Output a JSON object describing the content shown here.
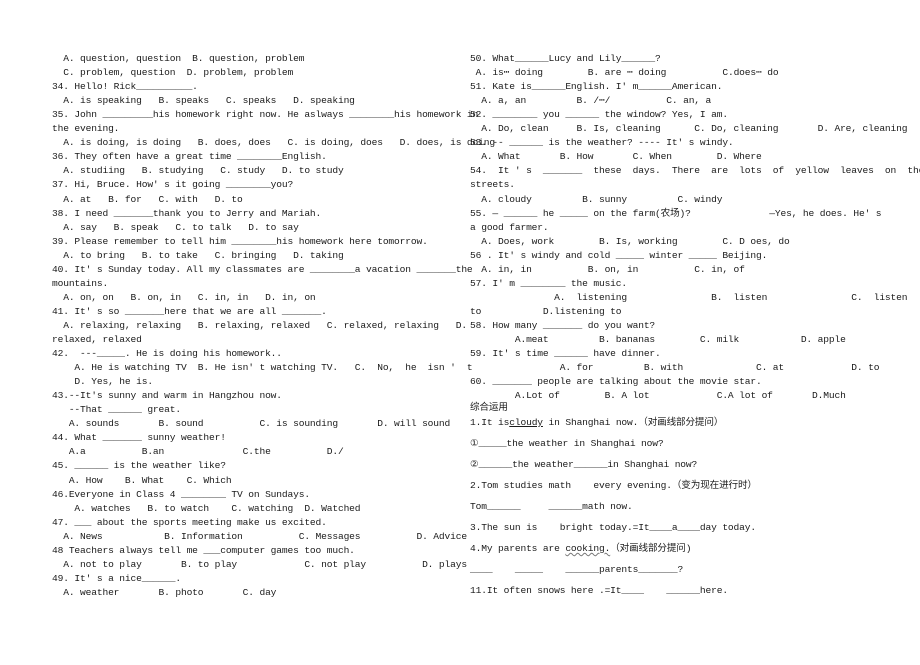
{
  "left_column": [
    {
      "text": "  A. question, question  B. question, problem"
    },
    {
      "text": "  C. problem, question  D. problem, problem"
    },
    {
      "text": "34. Hello! Rick__________."
    },
    {
      "text": "  A. is speaking   B. speaks   C. speaks   D. speaking"
    },
    {
      "text": "35. John _________his homework right now. He aslways ________his homework in"
    },
    {
      "text": "the evening."
    },
    {
      "text": "  A. is doing, is doing   B. does, does   C. is doing, does   D. does, is doing"
    },
    {
      "text": "36. They often have a great time ________English."
    },
    {
      "text": "  A. studiing   B. studying   C. study   D. to study"
    },
    {
      "text": "37. Hi, Bruce. How' s it going ________you?"
    },
    {
      "text": "  A. at   B. for   C. with   D. to"
    },
    {
      "text": "38. I need _______thank you to Jerry and Mariah."
    },
    {
      "text": "  A. say   B. speak   C. to talk   D. to say"
    },
    {
      "text": "39. Please remember to tell him ________his homework here tomorrow."
    },
    {
      "text": "  A. to bring   B. to take   C. bringing   D. taking"
    },
    {
      "text": "40. It' s Sunday today. All my classmates are ________a vacation _______the"
    },
    {
      "text": "mountains."
    },
    {
      "text": "  A. on, on   B. on, in   C. in, in   D. in, on"
    },
    {
      "text": "41. It' s so _______here that we are all _______."
    },
    {
      "text": "  A. relaxing, relaxing   B. relaxing, relaxed   C. relaxed, relaxing   D."
    },
    {
      "text": "relaxed, relaxed"
    },
    {
      "text": "42.  ---_____. He is doing his homework.."
    },
    {
      "text": "    A. He is watching TV  B. He isn' t watching TV.   C.  No,  he  isn '  t"
    },
    {
      "text": "    D. Yes, he is."
    },
    {
      "text": "43.--It's sunny and warm in Hangzhou now."
    },
    {
      "text": "   --That ______ great."
    },
    {
      "text": "   A. sounds       B. sound          C. is sounding       D. will sound"
    },
    {
      "text": "44. What _______ sunny weather!"
    },
    {
      "text": "   A.a          B.an              C.the          D./"
    },
    {
      "text": "45. ______ is the weather like?"
    },
    {
      "text": "   A. How    B. What    C. Which"
    },
    {
      "text": "46.Everyone in Class 4 ________ TV on Sundays."
    },
    {
      "text": "    A. watches   B. to watch    C. watching  D. Watched"
    },
    {
      "text": "47. ___ about the sports meeting make us excited."
    },
    {
      "text": "  A. News           B. Information          C. Messages          D. Advice"
    },
    {
      "text": "48 Teachers always tell me ___computer games too much."
    },
    {
      "text": "  A. not to play       B. to play            C. not play          D. plays"
    },
    {
      "text": "49. It' s a nice______."
    },
    {
      "text": "  A. weather       B. photo       C. day"
    }
  ],
  "right_column": [
    {
      "text": "50. What______Lucy and Lily______?"
    },
    {
      "text": " A. is⋯ doing        B. are ⋯ doing          C.does⋯ do"
    },
    {
      "text": "51. Kate is______English. I' m______American."
    },
    {
      "text": "  A. a, an         B. /⋯/          C. an, a"
    },
    {
      "text": "52. ________ you ______ the window? Yes, I am."
    },
    {
      "text": "  A. Do, clean     B. Is, cleaning      C. Do, cleaning       D. Are, cleaning"
    },
    {
      "text": "53. -- ______ is the weather? ---- It' s windy."
    },
    {
      "text": "  A. What       B. How       C. When        D. Where"
    },
    {
      "text": "54.  It ' s  _______  these  days.  There  are  lots  of  yellow  leaves  on  the"
    },
    {
      "text": "streets."
    },
    {
      "text": "  A. cloudy         B. sunny         C. windy"
    },
    {
      "text": "55. — ______ he _____ on the farm(农场)?              —Yes, he does. He' s"
    },
    {
      "text": "a good farmer."
    },
    {
      "text": "  A. Does, work        B. Is, working        C. D oes, do"
    },
    {
      "text": "56 . It' s windy and cold _____ winter _____ Beijing."
    },
    {
      "text": "  A. in, in          B. on, in          C. in, of"
    },
    {
      "text": "57. I' m ________ the music."
    },
    {
      "text": "               A.  listening               B.  listen               C.  listen"
    },
    {
      "text": "to           D.listening to"
    },
    {
      "text": "58. How many _______ do you want?"
    },
    {
      "text": "        A.meat         B. bananas        C. milk           D. apple"
    },
    {
      "text": "59. It' s time ______ have dinner."
    },
    {
      "text": "                A. for         B. with             C. at            D. to"
    },
    {
      "text": "60. _______ people are talking about the movie star."
    },
    {
      "text": "        A.Lot of        B. A lot            C.A lot of       D.Much"
    }
  ],
  "section": {
    "title": "综合运用",
    "items": [
      {
        "pre": "1.It is",
        "emph": "cloudy",
        "post": " in Shanghai now.（对画线部分提问）"
      },
      {
        "pre": "①_____the weather in Shanghai now?",
        "emph": "",
        "post": ""
      },
      {
        "pre": "②______the weather______in Shanghai now?",
        "emph": "",
        "post": ""
      },
      {
        "pre": "2.Tom studies math    every evening.（变为现在进行时）",
        "emph": "",
        "post": ""
      },
      {
        "pre": "Tom______     ______math now.",
        "emph": "",
        "post": ""
      },
      {
        "pre": "3.The sun is    bright today.=It____a____day today.",
        "emph": "",
        "post": ""
      },
      {
        "pre": "4.My parents are ",
        "emph": "cooking.",
        "post": "（对画线部分提问)"
      },
      {
        "pre": "____    _____    ______parents_______?",
        "emph": "",
        "post": ""
      },
      {
        "pre": "11.It often snows here .=It____    ______here.",
        "emph": "",
        "post": ""
      }
    ]
  }
}
